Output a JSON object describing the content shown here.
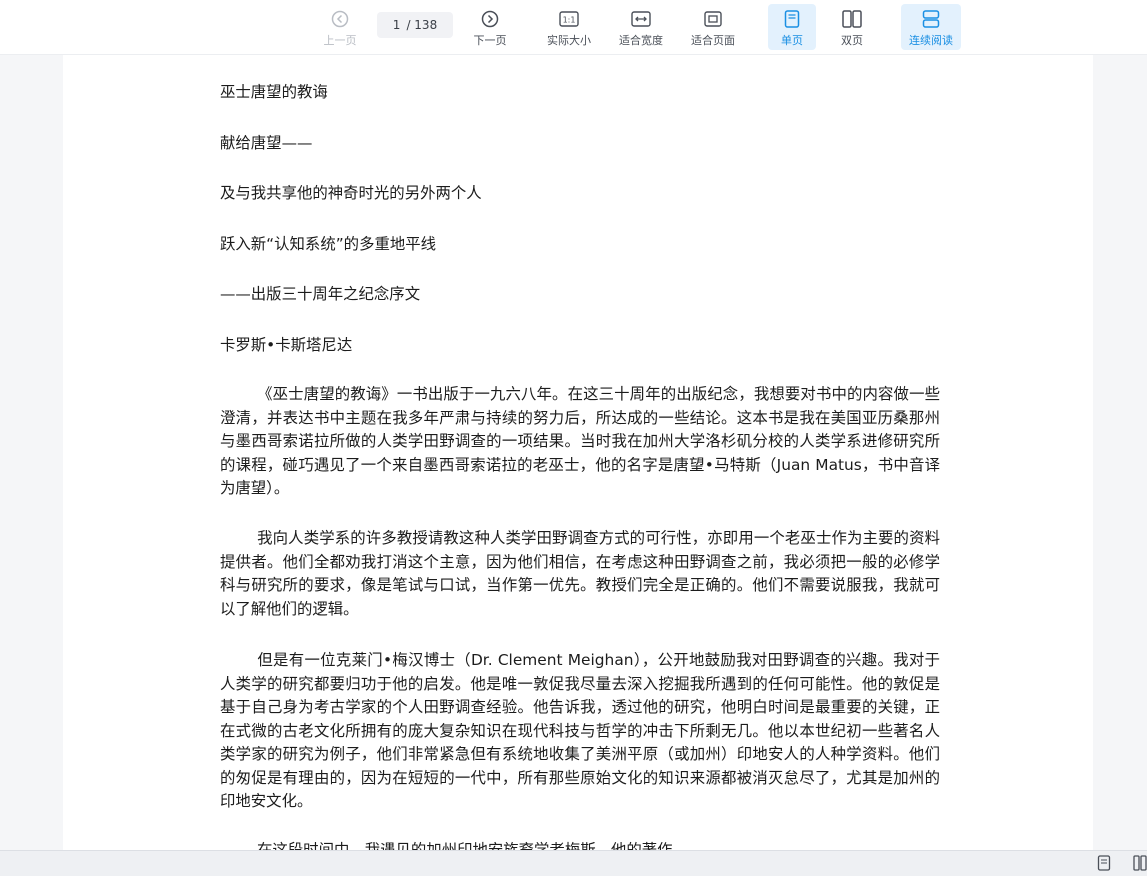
{
  "toolbar": {
    "prev": "上一页",
    "next": "下一页",
    "page_current": "1",
    "page_total": "/ 138",
    "actual_size": "实际大小",
    "fit_width": "适合宽度",
    "fit_page": "适合页面",
    "single_page": "单页",
    "double_page": "双页",
    "continuous": "连续阅读"
  },
  "colors": {
    "accent": "#1a8fe3",
    "active_bg": "#e3f1fd",
    "disabled": "#b9bdc4"
  },
  "document": {
    "lines": [
      "巫士唐望的教诲",
      "献给唐望——",
      "及与我共享他的神奇时光的另外两个人",
      "跃入新“认知系统”的多重地平线",
      "——出版三十周年之纪念序文",
      "卡罗斯•卡斯塔尼达"
    ],
    "paragraphs": [
      "《巫士唐望的教诲》一书出版于一九六八年。在这三十周年的出版纪念，我想要对书中的内容做一些澄清，并表达书中主题在我多年严肃与持续的努力后，所达成的一些结论。这本书是我在美国亚历桑那州与墨西哥索诺拉所做的人类学田野调查的一项结果。当时我在加州大学洛杉矶分校的人类学系进修研究所的课程，碰巧遇见了一个来自墨西哥索诺拉的老巫士，他的名字是唐望•马特斯（Juan Matus，书中音译为唐望）。",
      "我向人类学系的许多教授请教这种人类学田野调查方式的可行性，亦即用一个老巫士作为主要的资料提供者。他们全都劝我打消这个主意，因为他们相信，在考虑这种田野调查之前，我必须把一般的必修学科与研究所的要求，像是笔试与口试，当作第一优先。教授们完全是正确的。他们不需要说服我，我就可以了解他们的逻辑。",
      "但是有一位克莱门•梅汉博士（Dr. Clement Meighan），公开地鼓励我对田野调查的兴趣。我对于人类学的研究都要归功于他的启发。他是唯一敦促我尽量去深入挖掘我所遇到的任何可能性。他的敦促是基于自己身为考古学家的个人田野调查经验。他告诉我，透过他的研究，他明白时间是最重要的关键，正在式微的古老文化所拥有的庞大复杂知识在现代科技与哲学的冲击下所剩无几。他以本世纪初一些著名人类学家的研究为例子，他们非常紧急但有系统地收集了美洲平原（或加州）印地安人的人种学资料。他们的匆促是有理由的，因为在短短的一代中，所有那些原始文化的知识来源都被消灭怠尽了，尤其是加州的印地安文化。",
      "在这段时间中，我遇见的加州印地安族裔学者梅斯，他的著作"
    ]
  }
}
